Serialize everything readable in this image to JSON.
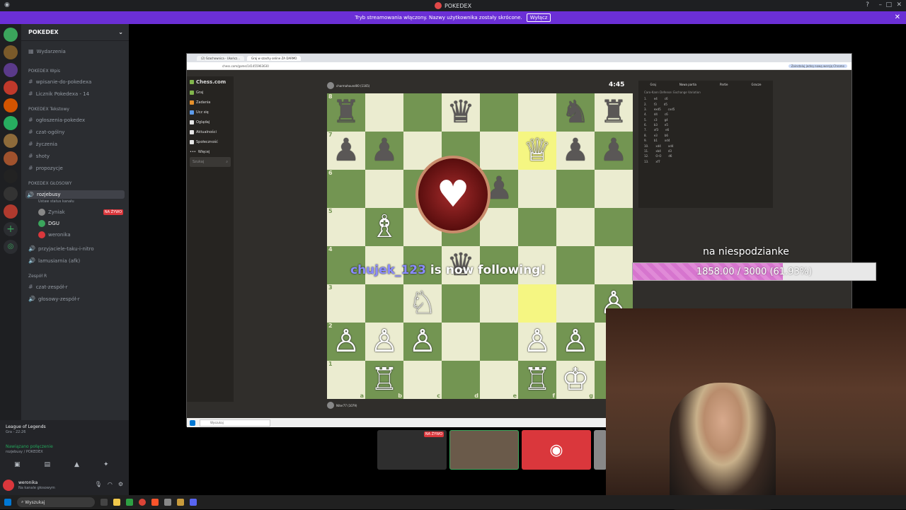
{
  "window": {
    "title": "POKEDEX"
  },
  "banner": {
    "text": "Tryb streamowania włączony. Nazwy użytkownika zostały skrócone.",
    "button": "Wyłącz"
  },
  "server": {
    "name": "POKEDEX"
  },
  "channels": {
    "events": "Wydarzenia",
    "cat_wpis": "POKEDEX Wpis",
    "wpisanie": "wpisanie-do-pokedexa",
    "licznik": "Licznik Pokedexa - 14",
    "cat_tekst": "POKEDEX Tekstowy",
    "ogloszenia": "ogłoszenia-pokedex",
    "czat": "czat-ogólny",
    "zyczenia": "życzenia",
    "shoty": "shoty",
    "propozycje": "propozycje",
    "cat_glos": "POKEDEX GŁOSOWY",
    "rozjebusy": "rozjebusy",
    "status": "Ustaw status kanału",
    "user1": "Zyniak",
    "live": "NA ŻYWO",
    "user2": "DGU",
    "user3": "weronika",
    "przyjaciele": "przyjaciele-taku-i-nitro",
    "lamusiarnia": "lamusiarnia (afk)",
    "cat_zespol": "Zespół R",
    "czat_r": "czat-zespół-r",
    "glos_r": "głosowy-zespół-r"
  },
  "activity": {
    "game": "League of Legends",
    "time": "Gra - 22:26",
    "conn": "Nawiązano połączenie",
    "conn_sub": "rozjebusy / POKEDEX"
  },
  "user": {
    "name": "weronika",
    "sub": "Na kanale głosowym"
  },
  "taskbar": {
    "search": "Wyszukaj"
  },
  "browser": {
    "tab1": "(2) Szachownica - Ukończ...",
    "tab2": "Graj w szachy online ZA DARMO",
    "url": "chess.com/game/141455963630",
    "update": "Zainstaluj jedną nową wersję Chrome"
  },
  "chess": {
    "logo": "Chess.com",
    "menu": [
      "Graj",
      "Zadania",
      "Ucz się",
      "Oglądaj",
      "Aktualności",
      "Społeczność",
      "Więcej"
    ],
    "search": "Szukaj",
    "opponent": "charmahound00 (1165)",
    "me": "Niter77 (1079)",
    "clock": "4:45",
    "opening": "Caro-Kann Defense: Exchange Variation",
    "panel_tabs": [
      "Graj",
      "Nowa partia",
      "Partie",
      "Gracze"
    ],
    "moves": [
      [
        "1.",
        "e4",
        "c6"
      ],
      [
        "2.",
        "f3",
        "d5"
      ],
      [
        "3.",
        "exd5",
        "cxd5"
      ],
      [
        "4.",
        "d4",
        "c6"
      ],
      [
        "5.",
        "c3",
        "g4"
      ],
      [
        "6.",
        "b3",
        "e5"
      ],
      [
        "7.",
        "xf3",
        "e6"
      ],
      [
        "8.",
        "e3",
        "b6"
      ],
      [
        "9.",
        "b1",
        "xd4"
      ],
      [
        "10.",
        "xd4",
        "xd4"
      ],
      [
        "11.",
        "xb4",
        "d3"
      ],
      [
        "12.",
        "O-O",
        "d6"
      ],
      [
        "13.",
        "xf7",
        ""
      ]
    ],
    "pieces": {
      "8": [
        "♜",
        "",
        "",
        "♛",
        "",
        "",
        "♞",
        "♜"
      ],
      "7": [
        "♟",
        "♟",
        "",
        "",
        "",
        "♕",
        "♟",
        "♟"
      ],
      "6": [
        "",
        "",
        "",
        "",
        "♟",
        "",
        "",
        ""
      ],
      "5": [
        "",
        "♗",
        "",
        "",
        "",
        "",
        "",
        ""
      ],
      "4": [
        "",
        "",
        "",
        "♛",
        "",
        "",
        "",
        ""
      ],
      "3": [
        "",
        "",
        "♘",
        "",
        "",
        "",
        "",
        "♙"
      ],
      "2": [
        "♙",
        "♙",
        "♙",
        "",
        "",
        "♙",
        "♙",
        ""
      ],
      "1": [
        "",
        "♖",
        "",
        "",
        "",
        "♖",
        "♔",
        ""
      ]
    },
    "colors": {
      "8": [
        "b",
        "",
        "",
        "b",
        "",
        "",
        "b",
        "b"
      ],
      "7": [
        "b",
        "b",
        "",
        "",
        "",
        "w",
        "b",
        "b"
      ],
      "6": [
        "",
        "",
        "",
        "",
        "b",
        "",
        "",
        ""
      ],
      "5": [
        "",
        "w",
        "",
        "",
        "",
        "",
        "",
        ""
      ],
      "4": [
        "",
        "",
        "",
        "b",
        "",
        "",
        "",
        ""
      ],
      "3": [
        "",
        "",
        "w",
        "",
        "",
        "",
        "",
        "w"
      ],
      "2": [
        "w",
        "w",
        "w",
        "",
        "",
        "w",
        "w",
        ""
      ],
      "1": [
        "",
        "w",
        "",
        "",
        "",
        "w",
        "w",
        ""
      ]
    },
    "files": [
      "a",
      "b",
      "c",
      "d",
      "e",
      "f",
      "g",
      "h"
    ]
  },
  "alert": {
    "user": "chujek_123",
    "text": "is now following!"
  },
  "goal": {
    "title": "na niespodzianke",
    "progress": "1858.00 / 3000 (61.93%)",
    "fraction": 0.6193
  },
  "thumbs": {
    "live": "NA ŻYWO"
  },
  "colors": {
    "banner": "#6b2fd6",
    "discord": "#da373c",
    "board_dark": "#739552",
    "board_light": "#ebecd0",
    "highlight": "#f5f682"
  }
}
